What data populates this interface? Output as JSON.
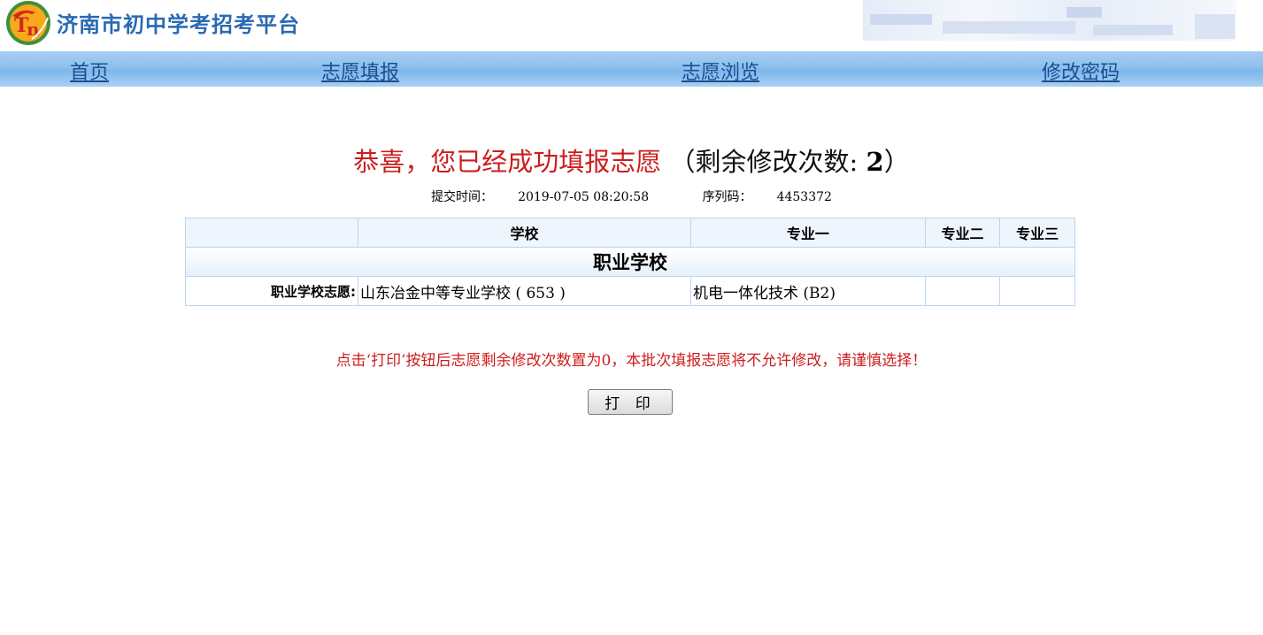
{
  "header": {
    "site_title": "济南市初中学考招考平台",
    "logo_icon": "logo-tn-icon"
  },
  "nav": {
    "items": [
      {
        "label": "首页"
      },
      {
        "label": "志愿填报"
      },
      {
        "label": "志愿浏览"
      },
      {
        "label": "修改密码"
      }
    ]
  },
  "result": {
    "congrats_text": "恭喜，您已经成功填报志愿",
    "remaining_prefix": "（剩余修改次数: ",
    "remaining_count": "2",
    "remaining_suffix": "）",
    "submit_time_label": "提交时间：",
    "submit_time": "2019-07-05 08:20:58",
    "serial_label": "序列码：",
    "serial": "4453372"
  },
  "table": {
    "headers": [
      "",
      "学校",
      "专业一",
      "专业二",
      "专业三"
    ],
    "section_title": "职业学校",
    "row": {
      "label": "职业学校志愿:",
      "school": "山东冶金中等专业学校 ( 653 )",
      "major1": "机电一体化技术 (B2)",
      "major2": "",
      "major3": ""
    }
  },
  "warning": "点击‘打印’按钮后志愿剩余修改次数置为0，本批次填报志愿将不允许修改，请谨慎选择！",
  "print_button": "打 印",
  "colors": {
    "accent_red": "#cc1d1d",
    "title_blue": "#2a6ab3",
    "nav_blue": "#8ebfee"
  }
}
